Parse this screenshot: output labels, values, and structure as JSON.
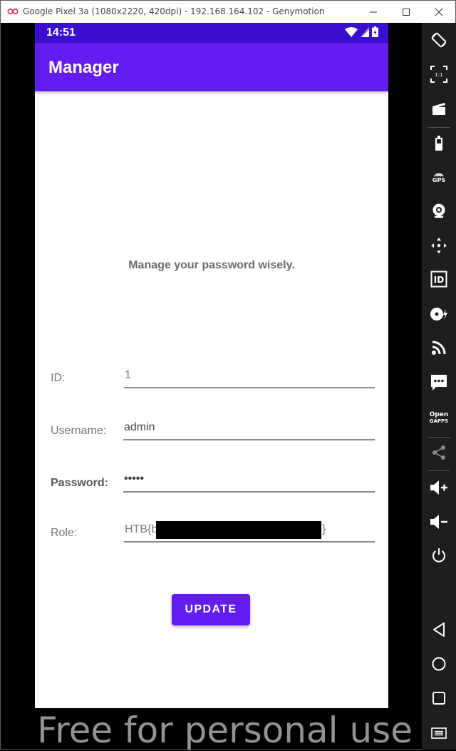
{
  "window": {
    "title": "Google Pixel 3a (1080x2220, 420dpi) - 192.168.164.102 - Genymotion"
  },
  "status_bar": {
    "time": "14:51"
  },
  "app_bar": {
    "title": "Manager"
  },
  "main": {
    "tagline": "Manage your password wisely.",
    "id": {
      "label": "ID:",
      "value": "1"
    },
    "username": {
      "label": "Username:",
      "value": "admin"
    },
    "password": {
      "label": "Password:",
      "value": "•••••"
    },
    "role": {
      "label": "Role:",
      "value_prefix": "HTB{b",
      "value_suffix": "}"
    },
    "update_label": "UPDATE"
  },
  "sidebar": {
    "zoom_label": "1:1",
    "gps_label": "GPS",
    "id_label": "ID",
    "opengapps_line1": "Open",
    "opengapps_line2": "GAPPS"
  },
  "watermark": "Free for personal use",
  "colors": {
    "accent": "#621cf0",
    "status_bar": "#3a0fcf",
    "sidebar": "#1e1e1e"
  }
}
